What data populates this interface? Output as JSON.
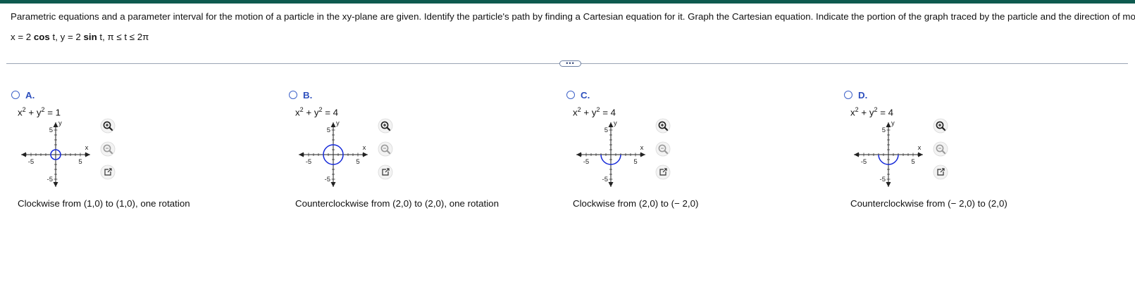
{
  "question": {
    "prompt": "Parametric equations and a parameter interval for the motion of a particle in the xy-plane are given. Identify the particle's path by finding a Cartesian equation for it. Graph the Cartesian equation. Indicate the portion of the graph traced by the particle and the direction of motion.",
    "eq_x_pre": "x = 2 ",
    "eq_cos": "cos",
    "eq_mid": " t, y = 2 ",
    "eq_sin": "sin",
    "eq_post": " t, π ≤ t ≤ 2π"
  },
  "divider_handle": "•••",
  "graph_labels": {
    "y": "y",
    "x": "x",
    "neg5": "-5",
    "pos5": "5",
    "y5": "5",
    "yneg5": "-5"
  },
  "colors": {
    "accent": "#2d4fbd",
    "curve": "#1428d8",
    "topbar": "#0e5a4f"
  },
  "choices": [
    {
      "letter": "A.",
      "eq_rhs": "= 1",
      "description": "Clockwise from (1,0) to (1,0), one rotation",
      "curve": "full-circle",
      "radius": 1
    },
    {
      "letter": "B.",
      "eq_rhs": "= 4",
      "description": "Counterclockwise from (2,0) to (2,0), one rotation",
      "curve": "full-circle",
      "radius": 2
    },
    {
      "letter": "C.",
      "eq_rhs": "= 4",
      "description": "Clockwise from (2,0) to (− 2,0)",
      "curve": "lower-semicircle",
      "radius": 2
    },
    {
      "letter": "D.",
      "eq_rhs": "= 4",
      "description": "Counterclockwise from (− 2,0) to (2,0)",
      "curve": "lower-semicircle",
      "radius": 2
    }
  ],
  "icons": {
    "zoom_in": "zoom-in-icon",
    "zoom_out": "zoom-out-icon",
    "popout": "external-link-icon"
  }
}
